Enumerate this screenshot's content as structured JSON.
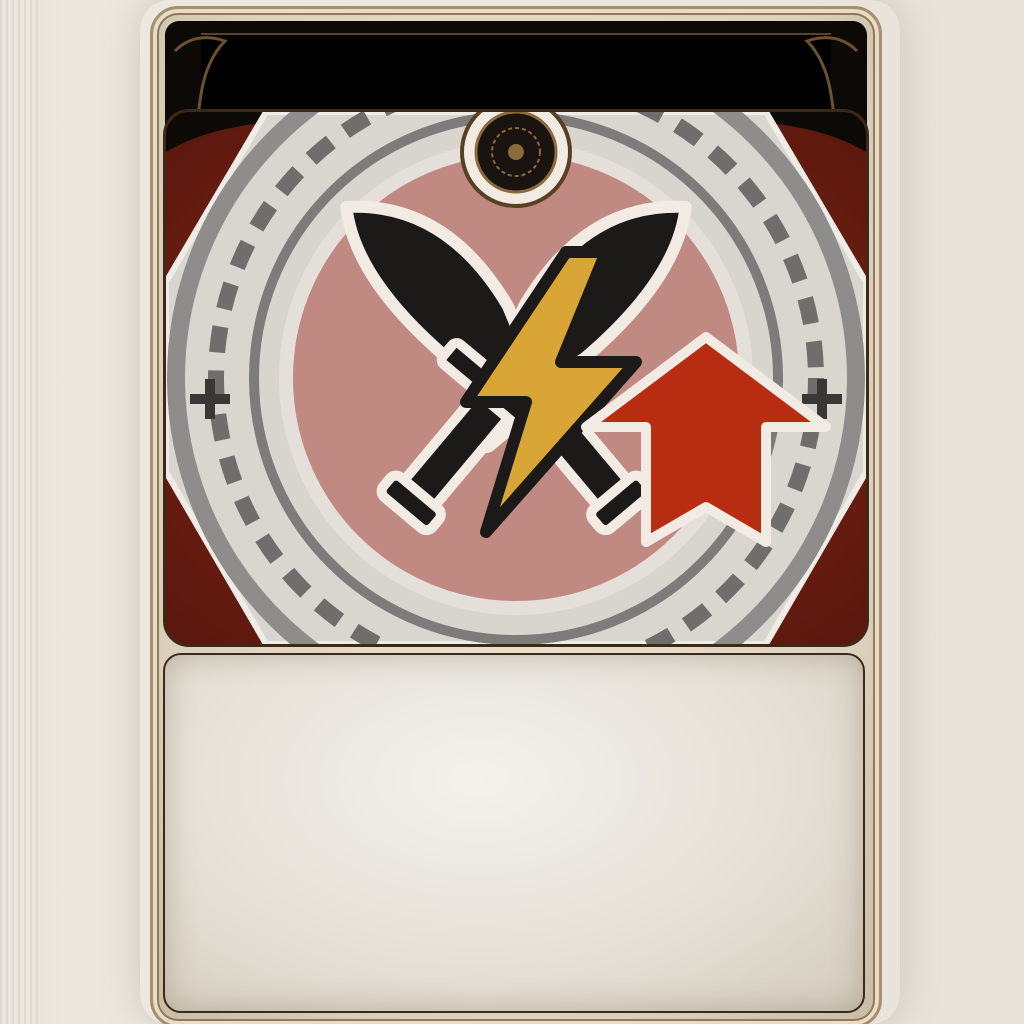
{
  "card": {
    "title": "",
    "description": ""
  },
  "emblem": {
    "icons": [
      "crossed-daggers-icon",
      "lightning-bolt-icon",
      "up-arrow-icon",
      "plus-icon"
    ]
  },
  "colors": {
    "frame": "#ddd1bd",
    "header": "#0c0906",
    "art_background": "#6b1f14",
    "ring": "#9a9a9a",
    "inner_circle": "#c08a82",
    "bolt": "#d9a536",
    "arrow": "#b82d12",
    "dagger": "#1c1a19"
  }
}
